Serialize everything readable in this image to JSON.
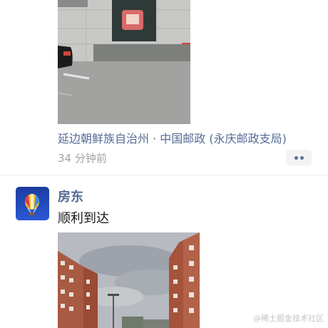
{
  "post1": {
    "location": "延边朝鲜族自治州 · 中国邮政 (永庆邮政支局)",
    "time": "34 分钟前",
    "photo_sign_text": "邮"
  },
  "post2": {
    "username": "房东",
    "text": "顺利到达"
  },
  "watermark": "@稀土掘金技术社区",
  "icons": {
    "more": "more-dots-icon",
    "avatar": "hot-air-balloon-icon"
  },
  "colors": {
    "link": "#576b95",
    "time": "#a2a2a2",
    "text": "#191919"
  }
}
